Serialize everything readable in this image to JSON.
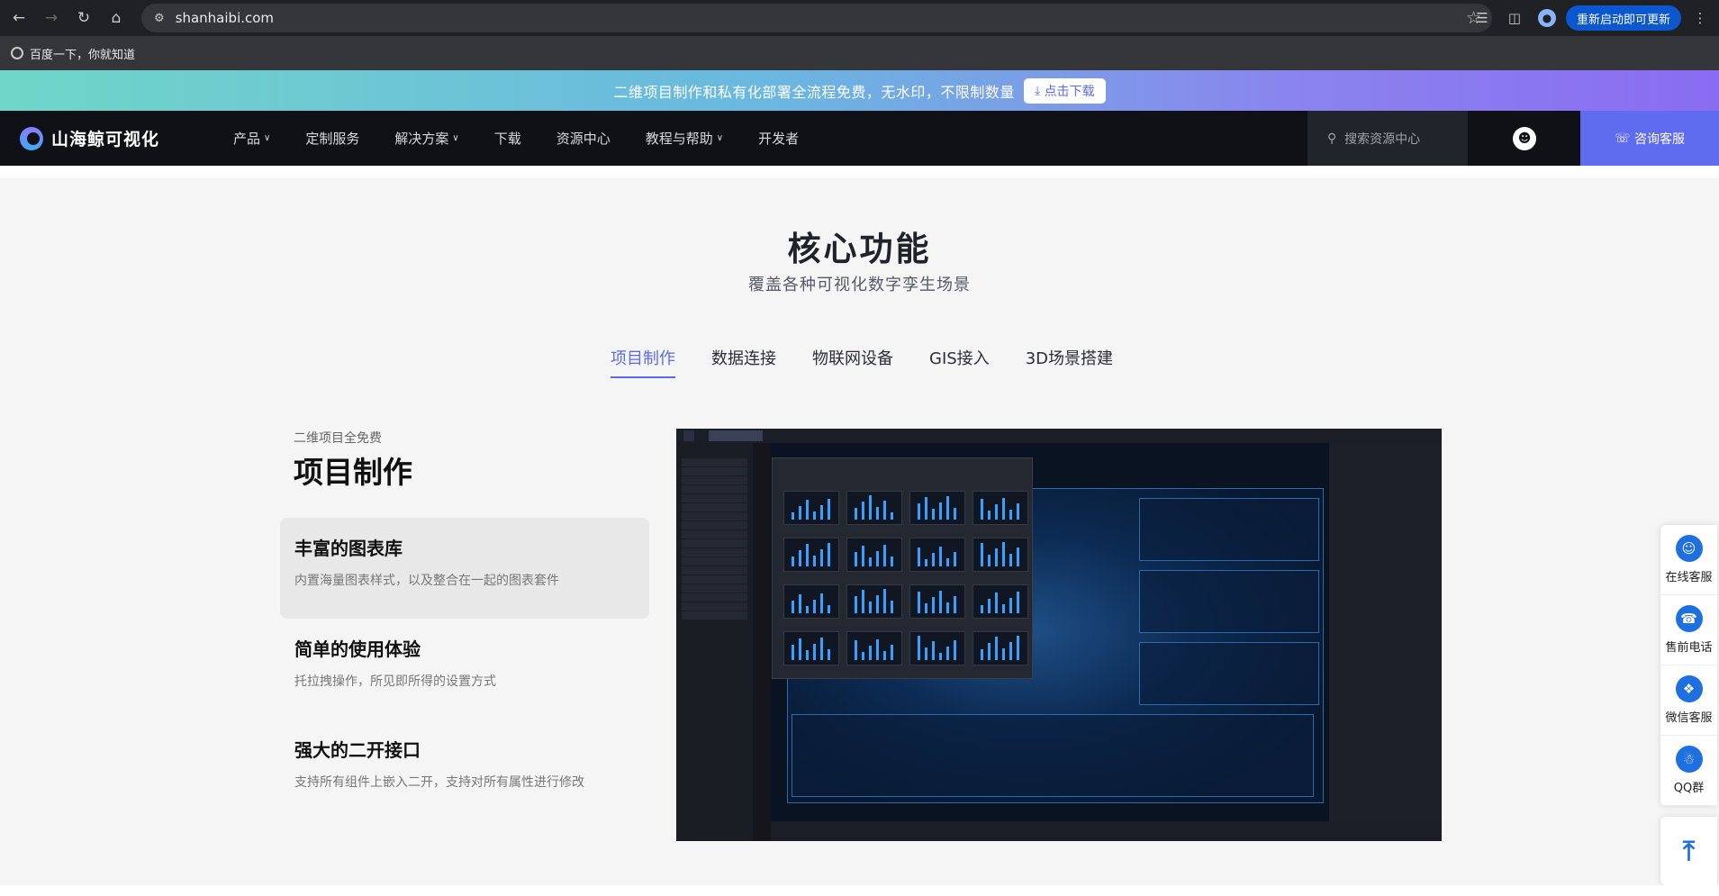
{
  "browser": {
    "url": "shanhaibi.com",
    "bookmark": "百度一下，你就知道",
    "update_label": "重新启动即可更新"
  },
  "banner": {
    "text": "二维项目制作和私有化部署全流程免费，无水印，不限制数量",
    "button": "点击下载"
  },
  "site": {
    "logo": "山海鲸可视化",
    "nav": [
      {
        "label": "产品",
        "dropdown": true
      },
      {
        "label": "定制服务",
        "dropdown": false
      },
      {
        "label": "解决方案",
        "dropdown": true
      },
      {
        "label": "下载",
        "dropdown": false
      },
      {
        "label": "资源中心",
        "dropdown": false
      },
      {
        "label": "教程与帮助",
        "dropdown": true
      },
      {
        "label": "开发者",
        "dropdown": false
      }
    ],
    "search_placeholder": "搜索资源中心",
    "consult": "咨询客服"
  },
  "main": {
    "title": "核心功能",
    "subtitle": "覆盖各种可视化数字孪生场景",
    "tabs": [
      "项目制作",
      "数据连接",
      "物联网设备",
      "GIS接入",
      "3D场景搭建"
    ],
    "active_tab": 0,
    "section_small": "二维项目全免费",
    "section_title": "项目制作",
    "features": [
      {
        "title": "丰富的图表库",
        "desc": "内置海量图表样式，以及整合在一起的图表套件"
      },
      {
        "title": "简单的使用体验",
        "desc": "托拉拽操作，所见即所得的设置方式"
      },
      {
        "title": "强大的二开接口",
        "desc": "支持所有组件上嵌入二开，支持对所有属性进行修改"
      }
    ]
  },
  "sidebar": {
    "items": [
      {
        "label": "在线客服",
        "icon": "headset-icon"
      },
      {
        "label": "售前电话",
        "icon": "phone-icon"
      },
      {
        "label": "微信客服",
        "icon": "wechat-icon"
      },
      {
        "label": "QQ群",
        "icon": "qq-icon"
      }
    ]
  },
  "colors": {
    "accent": "#5b6cf0",
    "nav_bg": "#0f1117",
    "side_icon": "#1e6fe0"
  }
}
